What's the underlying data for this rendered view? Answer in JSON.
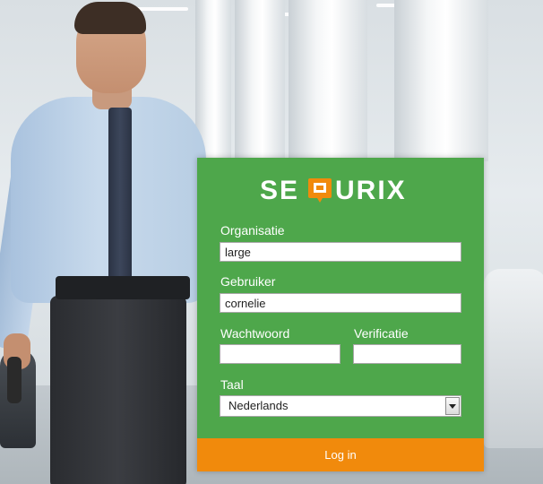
{
  "brand": {
    "logo_text": "SEQURIX",
    "colors": {
      "panel_green": "#4ea74b",
      "accent_orange": "#f18a0c",
      "text_white": "#ffffff"
    }
  },
  "form": {
    "organisation": {
      "label": "Organisatie",
      "value": "large"
    },
    "user": {
      "label": "Gebruiker",
      "value": "cornelie"
    },
    "password": {
      "label": "Wachtwoord",
      "value": ""
    },
    "verification": {
      "label": "Verificatie",
      "value": ""
    },
    "language": {
      "label": "Taal",
      "selected": "Nederlands"
    },
    "submit_label": "Log in"
  }
}
